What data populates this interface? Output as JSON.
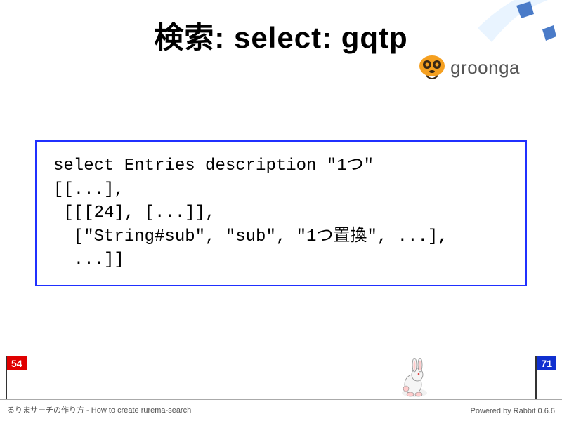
{
  "title": "検索: select: gqtp",
  "logo": {
    "name": "groonga"
  },
  "code": "select Entries description \"1つ\"\n[[...],\n [[[24], [...]],\n  [\"String#sub\", \"sub\", \"1つ置換\", ...],\n  ...]]",
  "flags": {
    "left": "54",
    "right": "71"
  },
  "footer": {
    "left": "るりまサーチの作り方 - How to create rurema-search",
    "right": "Powered by Rabbit 0.6.6"
  }
}
